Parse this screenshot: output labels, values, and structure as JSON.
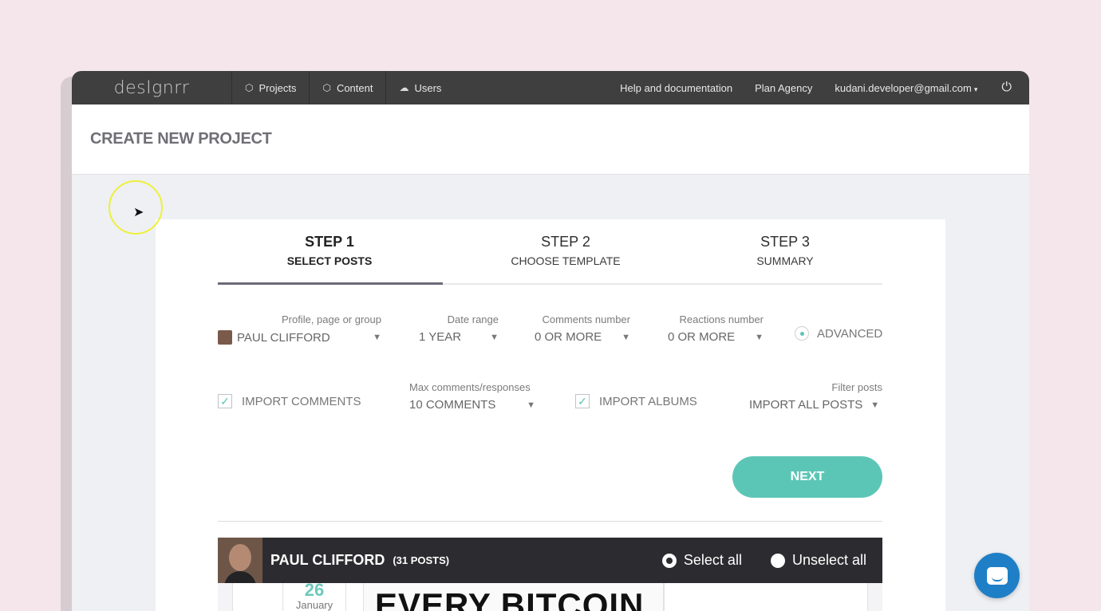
{
  "navbar": {
    "logo": "desIgnrr",
    "items": [
      {
        "label": "Projects",
        "icon": "box-icon"
      },
      {
        "label": "Content",
        "icon": "box-icon"
      },
      {
        "label": "Users",
        "icon": "users-icon"
      }
    ],
    "help": "Help and documentation",
    "plan": "Plan Agency",
    "user_email": "kudani.developer@gmail.com",
    "logout_icon": "logout-icon"
  },
  "page": {
    "title": "CREATE NEW PROJECT"
  },
  "steps": [
    {
      "num": "STEP 1",
      "label": "SELECT POSTS",
      "active": true
    },
    {
      "num": "STEP 2",
      "label": "CHOOSE TEMPLATE",
      "active": false
    },
    {
      "num": "STEP 3",
      "label": "SUMMARY",
      "active": false
    }
  ],
  "filters": {
    "profile": {
      "label": "Profile, page or group",
      "value": "PAUL CLIFFORD"
    },
    "date_range": {
      "label": "Date range",
      "value": "1 YEAR"
    },
    "comments": {
      "label": "Comments number",
      "value": "0 OR MORE"
    },
    "reactions": {
      "label": "Reactions number",
      "value": "0 OR MORE"
    },
    "advanced": "ADVANCED"
  },
  "options": {
    "import_comments": {
      "label": "IMPORT COMMENTS",
      "checked": true
    },
    "max_comments": {
      "label": "Max comments/responses",
      "value": "10 COMMENTS"
    },
    "import_albums": {
      "label": "IMPORT ALBUMS",
      "checked": true
    },
    "filter_posts": {
      "label": "Filter posts",
      "value": "IMPORT ALL POSTS"
    }
  },
  "next_label": "NEXT",
  "profile_bar": {
    "name": "PAUL CLIFFORD",
    "count": "(31 POSTS)",
    "select_all": "Select all",
    "unselect_all": "Unselect all"
  },
  "post_preview": {
    "day": "26",
    "month": "January",
    "headline": "EVERY BITCOIN"
  },
  "colors": {
    "accent": "#5cc6b6",
    "navbar": "#3f3f3f",
    "profile_bar": "#2c2c30",
    "chat": "#1f7fc6"
  }
}
